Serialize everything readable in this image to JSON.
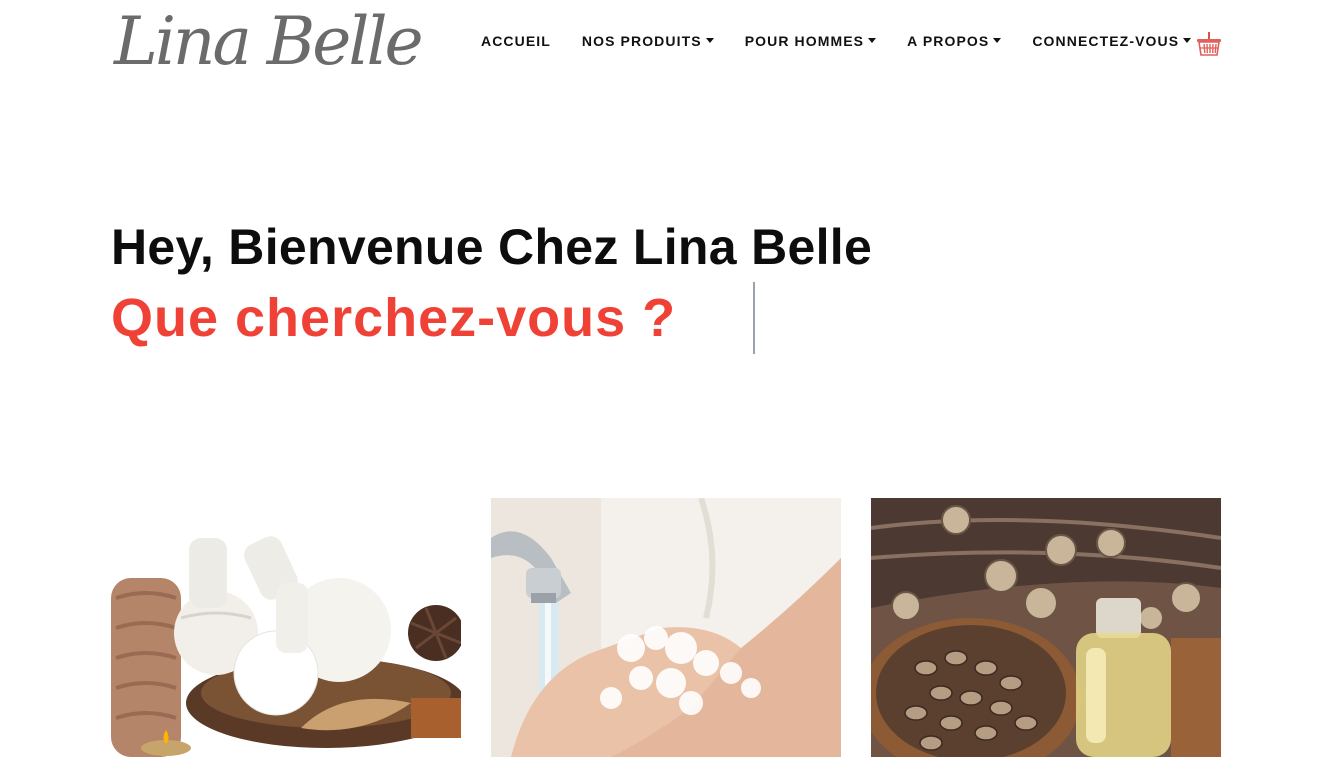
{
  "brand": {
    "logo_text": "Lina Belle"
  },
  "nav": {
    "items": [
      {
        "label": "ACCUEIL",
        "dropdown": false
      },
      {
        "label": "NOS PRODUITS",
        "dropdown": true
      },
      {
        "label": "POUR HOMMES",
        "dropdown": true
      },
      {
        "label": "A PROPOS",
        "dropdown": true
      },
      {
        "label": "CONNECTEZ-VOUS",
        "dropdown": true
      }
    ],
    "cart_icon": "basket-icon"
  },
  "hero": {
    "title": "Hey, Bienvenue Chez Lina Belle",
    "subtitle": "Que cherchez-vous ?"
  },
  "colors": {
    "accent": "#ef4136",
    "logo": "#6b6b6b",
    "text": "#0d0d0d"
  },
  "cards": [
    {
      "image": "spa-herbal-compress-image"
    },
    {
      "image": "hand-washing-image"
    },
    {
      "image": "castor-seeds-oil-image"
    }
  ]
}
